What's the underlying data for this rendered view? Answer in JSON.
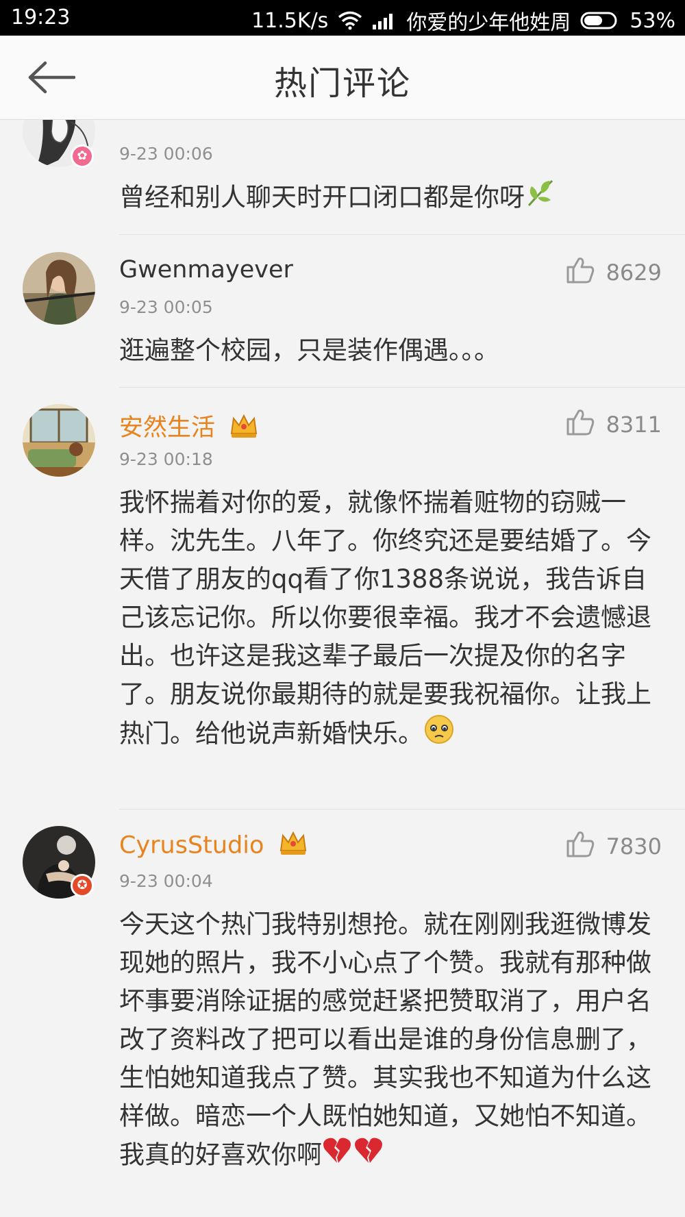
{
  "status": {
    "time": "19:23",
    "speed": "11.5K/s",
    "carrier": "你爱的少年他姓周",
    "battery": "53%"
  },
  "header": {
    "title": "热门评论"
  },
  "comments": [
    {
      "user": "",
      "likes": "",
      "time": "9-23 00:06",
      "text": "曾经和别人聊天时开口闭口都是你呀",
      "emoji_icon": "leaf-icon"
    },
    {
      "user": "Gwenmayever",
      "likes": "8629",
      "time": "9-23 00:05",
      "text": "逛遍整个校园，只是装作偶遇。。。"
    },
    {
      "user": "安然生活",
      "likes": "8311",
      "time": "9-23 00:18",
      "text": "我怀揣着对你的爱，就像怀揣着赃物的窃贼一样。沈先生。八年了。你终究还是要结婚了。今天借了朋友的qq看了你1388条说说，我告诉自己该忘记你。所以你要很幸福。我才不会遗憾退出。也许这是我这辈子最后一次提及你的名字了。朋友说你最期待的就是要我祝福你。让我上热门。给他说声新婚快乐。",
      "emoji_icon": "sad-face-icon"
    },
    {
      "user": "CyrusStudio",
      "likes": "7830",
      "time": "9-23 00:04",
      "text": "今天这个热门我特别想抢。就在刚刚我逛微博发现她的照片，我不小心点了个赞。我就有那种做坏事要消除证据的感觉赶紧把赞取消了，用户名改了资料改了把可以看出是谁的身份信息删了，生怕她知道我点了赞。其实我也不知道为什么这样做。暗恋一个人既怕她知道，又她怕不知道。我真的好喜欢你啊",
      "emoji_icon": "broken-heart-icon"
    }
  ],
  "colors": {
    "vip_name": "#e8831d",
    "muted": "#8f8f8f",
    "text": "#333333",
    "background": "#f3f3f3"
  }
}
